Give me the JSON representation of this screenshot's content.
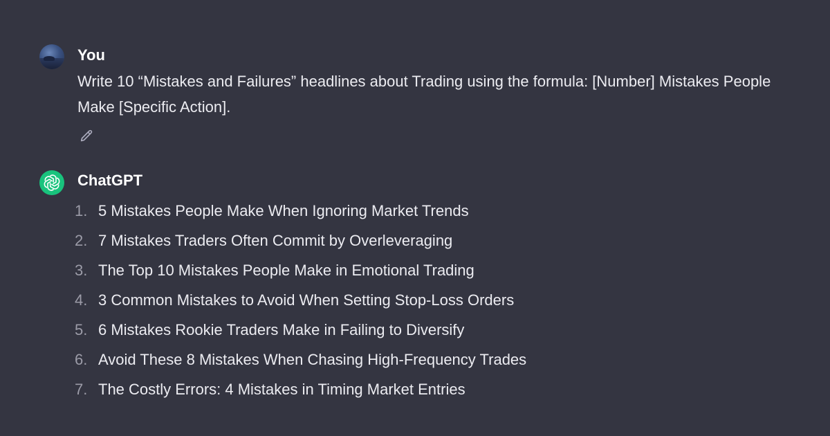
{
  "user_message": {
    "author": "You",
    "text": "Write 10 “Mistakes and Failures” headlines about Trading using the formula: [Number] Mistakes People Make [Specific Action].",
    "edit_icon": "pencil-icon"
  },
  "assistant_message": {
    "author": "ChatGPT",
    "logo_icon": "openai-logo-icon",
    "items": [
      {
        "number": "1.",
        "text": "5 Mistakes People Make When Ignoring Market Trends"
      },
      {
        "number": "2.",
        "text": "7 Mistakes Traders Often Commit by Overleveraging"
      },
      {
        "number": "3.",
        "text": "The Top 10 Mistakes People Make in Emotional Trading"
      },
      {
        "number": "4.",
        "text": "3 Common Mistakes to Avoid When Setting Stop-Loss Orders"
      },
      {
        "number": "5.",
        "text": "6 Mistakes Rookie Traders Make in Failing to Diversify"
      },
      {
        "number": "6.",
        "text": "Avoid These 8 Mistakes When Chasing High-Frequency Trades"
      },
      {
        "number": "7.",
        "text": "The Costly Errors: 4 Mistakes in Timing Market Entries"
      }
    ]
  },
  "colors": {
    "background": "#343541",
    "text": "#ececf1",
    "muted_number": "#9c9ca8",
    "assistant_avatar": "#19c37d"
  }
}
